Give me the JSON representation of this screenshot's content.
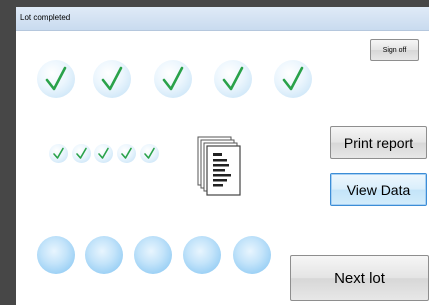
{
  "window": {
    "title": "Lot completed"
  },
  "buttons": {
    "sign_off": "Sign off",
    "print_report": "Print report",
    "view_data": "View Data",
    "next_lot": "Next lot"
  },
  "icons": {
    "large_checks": [
      "check-icon",
      "check-icon",
      "check-icon",
      "check-icon",
      "check-icon"
    ],
    "small_checks": [
      "check-icon",
      "check-icon",
      "check-icon",
      "check-icon",
      "check-icon"
    ],
    "pending_indicators": [
      "circle-icon",
      "circle-icon",
      "circle-icon",
      "circle-icon",
      "circle-icon"
    ],
    "documents": "documents-icon"
  },
  "colors": {
    "check": "#2aa24a",
    "accent_border": "#3c8dd6",
    "titlebar": "#c9dbef"
  }
}
